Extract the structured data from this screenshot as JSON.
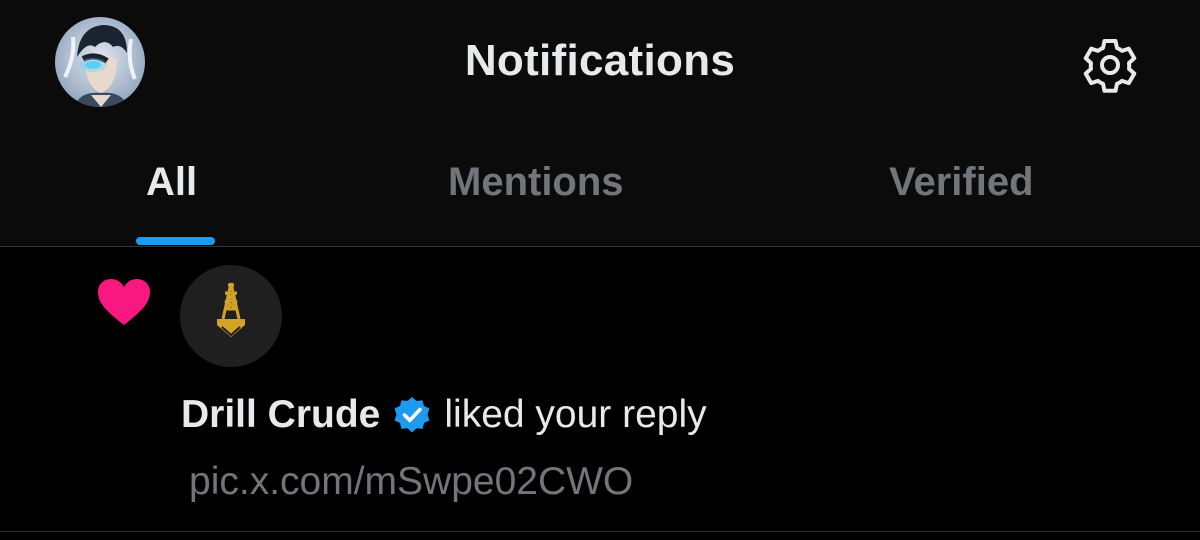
{
  "header": {
    "title": "Notifications",
    "avatar_icon": "profile-avatar",
    "settings_icon": "gear-icon"
  },
  "tabs": [
    {
      "label": "All",
      "active": true
    },
    {
      "label": "Mentions",
      "active": false
    },
    {
      "label": "Verified",
      "active": false
    }
  ],
  "notification": {
    "type_icon": "heart-icon",
    "user_name": "Drill Crude",
    "verified": true,
    "action": "liked your reply",
    "content": "pic.x.com/mSwpe02CWO"
  },
  "colors": {
    "accent": "#1d9bf0",
    "like": "#f91880",
    "text": "#e7e9ea",
    "muted": "#71767b",
    "logo_gold": "#d4a229"
  }
}
